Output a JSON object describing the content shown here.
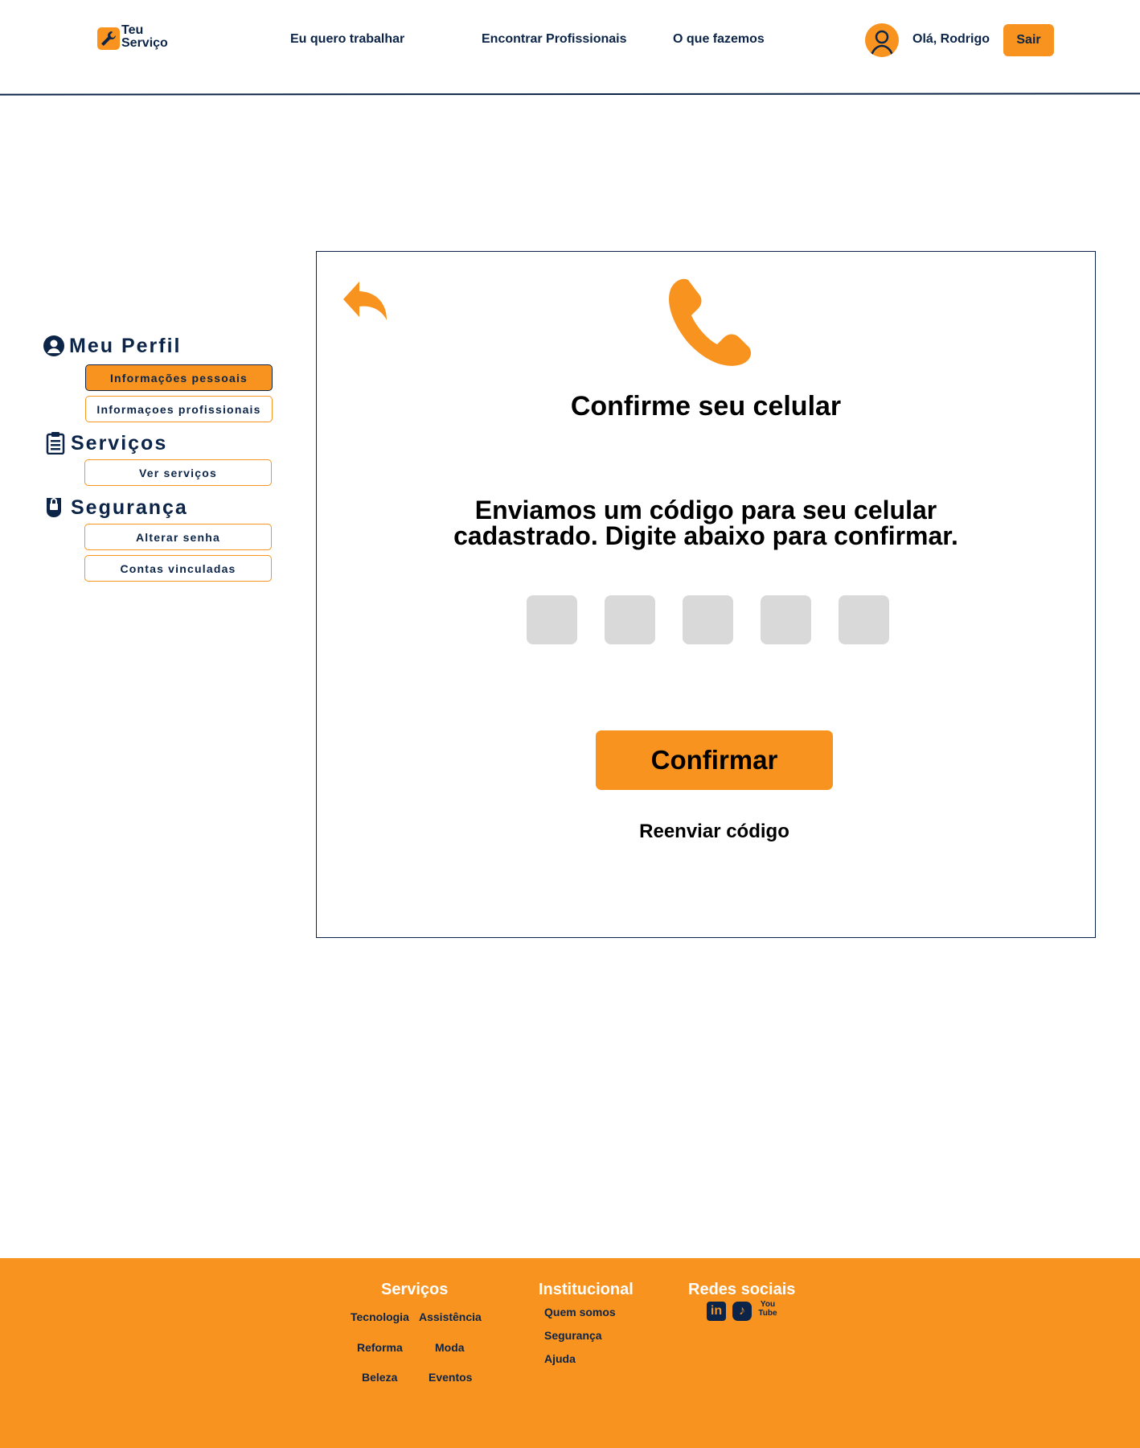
{
  "colors": {
    "accent": "#f7931e",
    "navy": "#0b2447",
    "code_box": "#d9d9d9"
  },
  "header": {
    "logo_line1": "Teu",
    "logo_line2": "Serviço",
    "nav": [
      "Eu quero trabalhar",
      "Encontrar Profissionais",
      "O que fazemos"
    ],
    "greeting": "Olá, Rodrigo",
    "logout_label": "Sair"
  },
  "sidebar": {
    "profile": {
      "title": "Meu Perfil",
      "icon": "user-circle-icon",
      "items": [
        {
          "label": "Informações pessoais",
          "active": true
        },
        {
          "label": "Informaçoes profissionais",
          "active": false
        }
      ]
    },
    "services": {
      "title": "Serviços",
      "icon": "clipboard-icon",
      "items": [
        {
          "label": "Ver serviços",
          "active": false
        }
      ]
    },
    "security": {
      "title": "Segurança",
      "icon": "security-icon",
      "items": [
        {
          "label": "Alterar senha",
          "active": false
        },
        {
          "label": "Contas vinculadas",
          "active": false
        }
      ]
    }
  },
  "card": {
    "back_icon": "reply-arrow-icon",
    "phone_icon": "phone-icon",
    "title": "Confirme seu  celular",
    "message_line1": "Enviamos um código para seu celular",
    "message_line2": "cadastrado. Digite abaixo para confirmar.",
    "code_fields": [
      "",
      "",
      "",
      "",
      ""
    ],
    "confirm_label": "Confirmar",
    "resend_label": "Reenviar código"
  },
  "footer": {
    "services_title": "Serviços",
    "services_col1": [
      "Tecnologia",
      "Reforma",
      "Beleza"
    ],
    "services_col2": [
      "Assistência",
      "Moda",
      "Eventos"
    ],
    "institutional_title": "Institucional",
    "institutional": [
      "Quem somos",
      "Segurança",
      "Ajuda"
    ],
    "social_title": "Redes sociais",
    "social": [
      {
        "name": "linkedin-icon",
        "label": "in"
      },
      {
        "name": "tiktok-icon",
        "label": "♪"
      },
      {
        "name": "youtube-icon",
        "label": "You Tube"
      }
    ]
  }
}
